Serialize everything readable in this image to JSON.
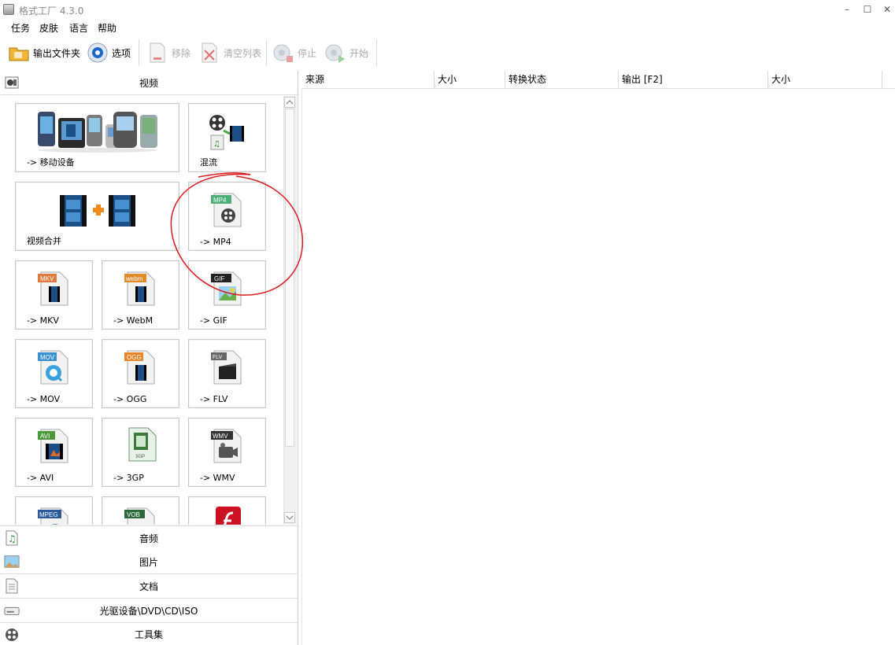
{
  "window": {
    "title": "格式工厂 4.3.0",
    "controls": [
      "–",
      "☐",
      "✕"
    ]
  },
  "menu": [
    "任务",
    "皮肤",
    "语言",
    "帮助"
  ],
  "toolbar": {
    "output_folder": "输出文件夹",
    "options": "选项",
    "remove": "移除",
    "clear_list": "清空列表",
    "stop": "停止",
    "start": "开始"
  },
  "categories": {
    "video": "视频",
    "audio": "音频",
    "image": "图片",
    "document": "文档",
    "disc": "光驱设备\\DVD\\CD\\ISO",
    "tools": "工具集"
  },
  "video_tiles": {
    "mobile": "-> 移动设备",
    "mux": "混流",
    "join": "视频合并",
    "mp4": "-> MP4",
    "mkv": "-> MKV",
    "webm": "-> WebM",
    "gif": "-> GIF",
    "mov": "-> MOV",
    "ogg": "-> OGG",
    "flv": "-> FLV",
    "avi": "-> AVI",
    "3gp": "-> 3GP",
    "wmv": "-> WMV"
  },
  "file_badges": {
    "mp4": "MP4",
    "mkv": "MKV",
    "webm": "webm",
    "gif": "GIF",
    "mov": "MOV",
    "ogg": "OGG",
    "flv": "FLV",
    "avi": "AVI",
    "3gp": "3GP",
    "wmv": "WMV",
    "mpeg": "MPEG",
    "vob": "VOB"
  },
  "table_columns": [
    "来源",
    "大小",
    "转换状态",
    "输出 [F2]",
    "大小"
  ],
  "colors": {
    "annotation_red": "#e0191e",
    "badge_mp4": "#4caf7a",
    "badge_mkv": "#e07a3c",
    "badge_webm": "#e08a2a",
    "badge_gif": "#222222",
    "badge_mov": "#3a8fd0",
    "badge_ogg": "#e8852a",
    "badge_flv": "#666666",
    "badge_avi": "#4a9a3a",
    "badge_3gp": "#3a7a3a",
    "badge_wmv": "#333333",
    "badge_mpeg": "#2a5a9a",
    "badge_vob": "#2a6a3a"
  }
}
